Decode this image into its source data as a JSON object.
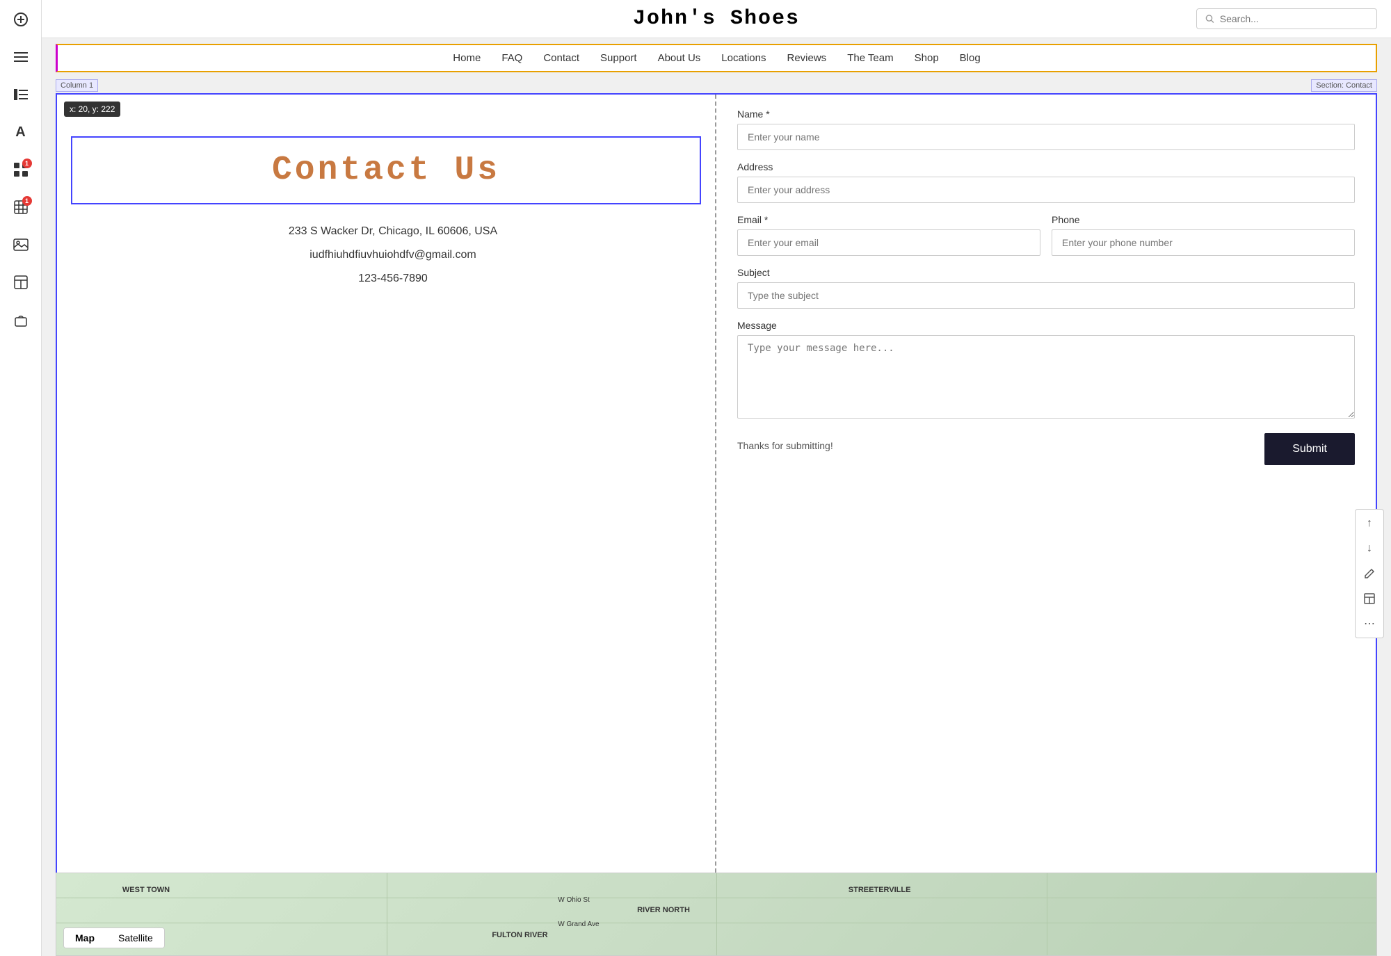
{
  "header": {
    "title": "John's Shoes",
    "search_placeholder": "Search..."
  },
  "nav": {
    "items": [
      {
        "label": "Home"
      },
      {
        "label": "FAQ"
      },
      {
        "label": "Contact"
      },
      {
        "label": "Support"
      },
      {
        "label": "About Us"
      },
      {
        "label": "Locations"
      },
      {
        "label": "Reviews"
      },
      {
        "label": "The Team"
      },
      {
        "label": "Shop"
      },
      {
        "label": "Blog"
      }
    ]
  },
  "labels": {
    "column": "Column 1",
    "section": "Section: Contact"
  },
  "tooltip": {
    "coords": "x: 20, y: 222"
  },
  "contact": {
    "title": "Contact Us",
    "address": "233 S Wacker Dr, Chicago, IL 60606, USA",
    "email": "iudfhiuhdfiuvhuiohdfv@gmail.com",
    "phone": "123-456-7890"
  },
  "form": {
    "name_label": "Name *",
    "name_placeholder": "Enter your name",
    "address_label": "Address",
    "address_placeholder": "Enter your address",
    "email_label": "Email *",
    "email_placeholder": "Enter your email",
    "phone_label": "Phone",
    "phone_placeholder": "Enter your phone number",
    "subject_label": "Subject",
    "subject_placeholder": "Type the subject",
    "message_label": "Message",
    "message_placeholder": "Type your message here...",
    "submit_label": "Submit",
    "thanks_text": "Thanks for submitting!"
  },
  "map": {
    "tab_map": "Map",
    "tab_satellite": "Satellite",
    "labels": [
      "WEST TOWN",
      "RIVER NORTH",
      "STREETERVILLE",
      "FULTON RIVER",
      "W Ohio St",
      "W Grand Ave"
    ]
  },
  "sidebar": {
    "icons": [
      {
        "name": "add-icon",
        "symbol": "+"
      },
      {
        "name": "menu-icon",
        "symbol": "☰"
      },
      {
        "name": "list-icon",
        "symbol": "▤"
      },
      {
        "name": "text-icon",
        "symbol": "A"
      },
      {
        "name": "apps-icon",
        "symbol": "⊞",
        "badge": "1"
      },
      {
        "name": "grid-icon",
        "symbol": "⊟",
        "badge": "1"
      },
      {
        "name": "image-icon",
        "symbol": "🖼"
      },
      {
        "name": "table-icon",
        "symbol": "⊞"
      },
      {
        "name": "bag-icon",
        "symbol": "💼"
      }
    ]
  },
  "float_controls": [
    {
      "name": "up-icon",
      "symbol": "↑"
    },
    {
      "name": "down-icon",
      "symbol": "↓"
    },
    {
      "name": "edit-icon",
      "symbol": "✏"
    },
    {
      "name": "layout-icon",
      "symbol": "⊟"
    },
    {
      "name": "more-icon",
      "symbol": "⋯"
    }
  ]
}
